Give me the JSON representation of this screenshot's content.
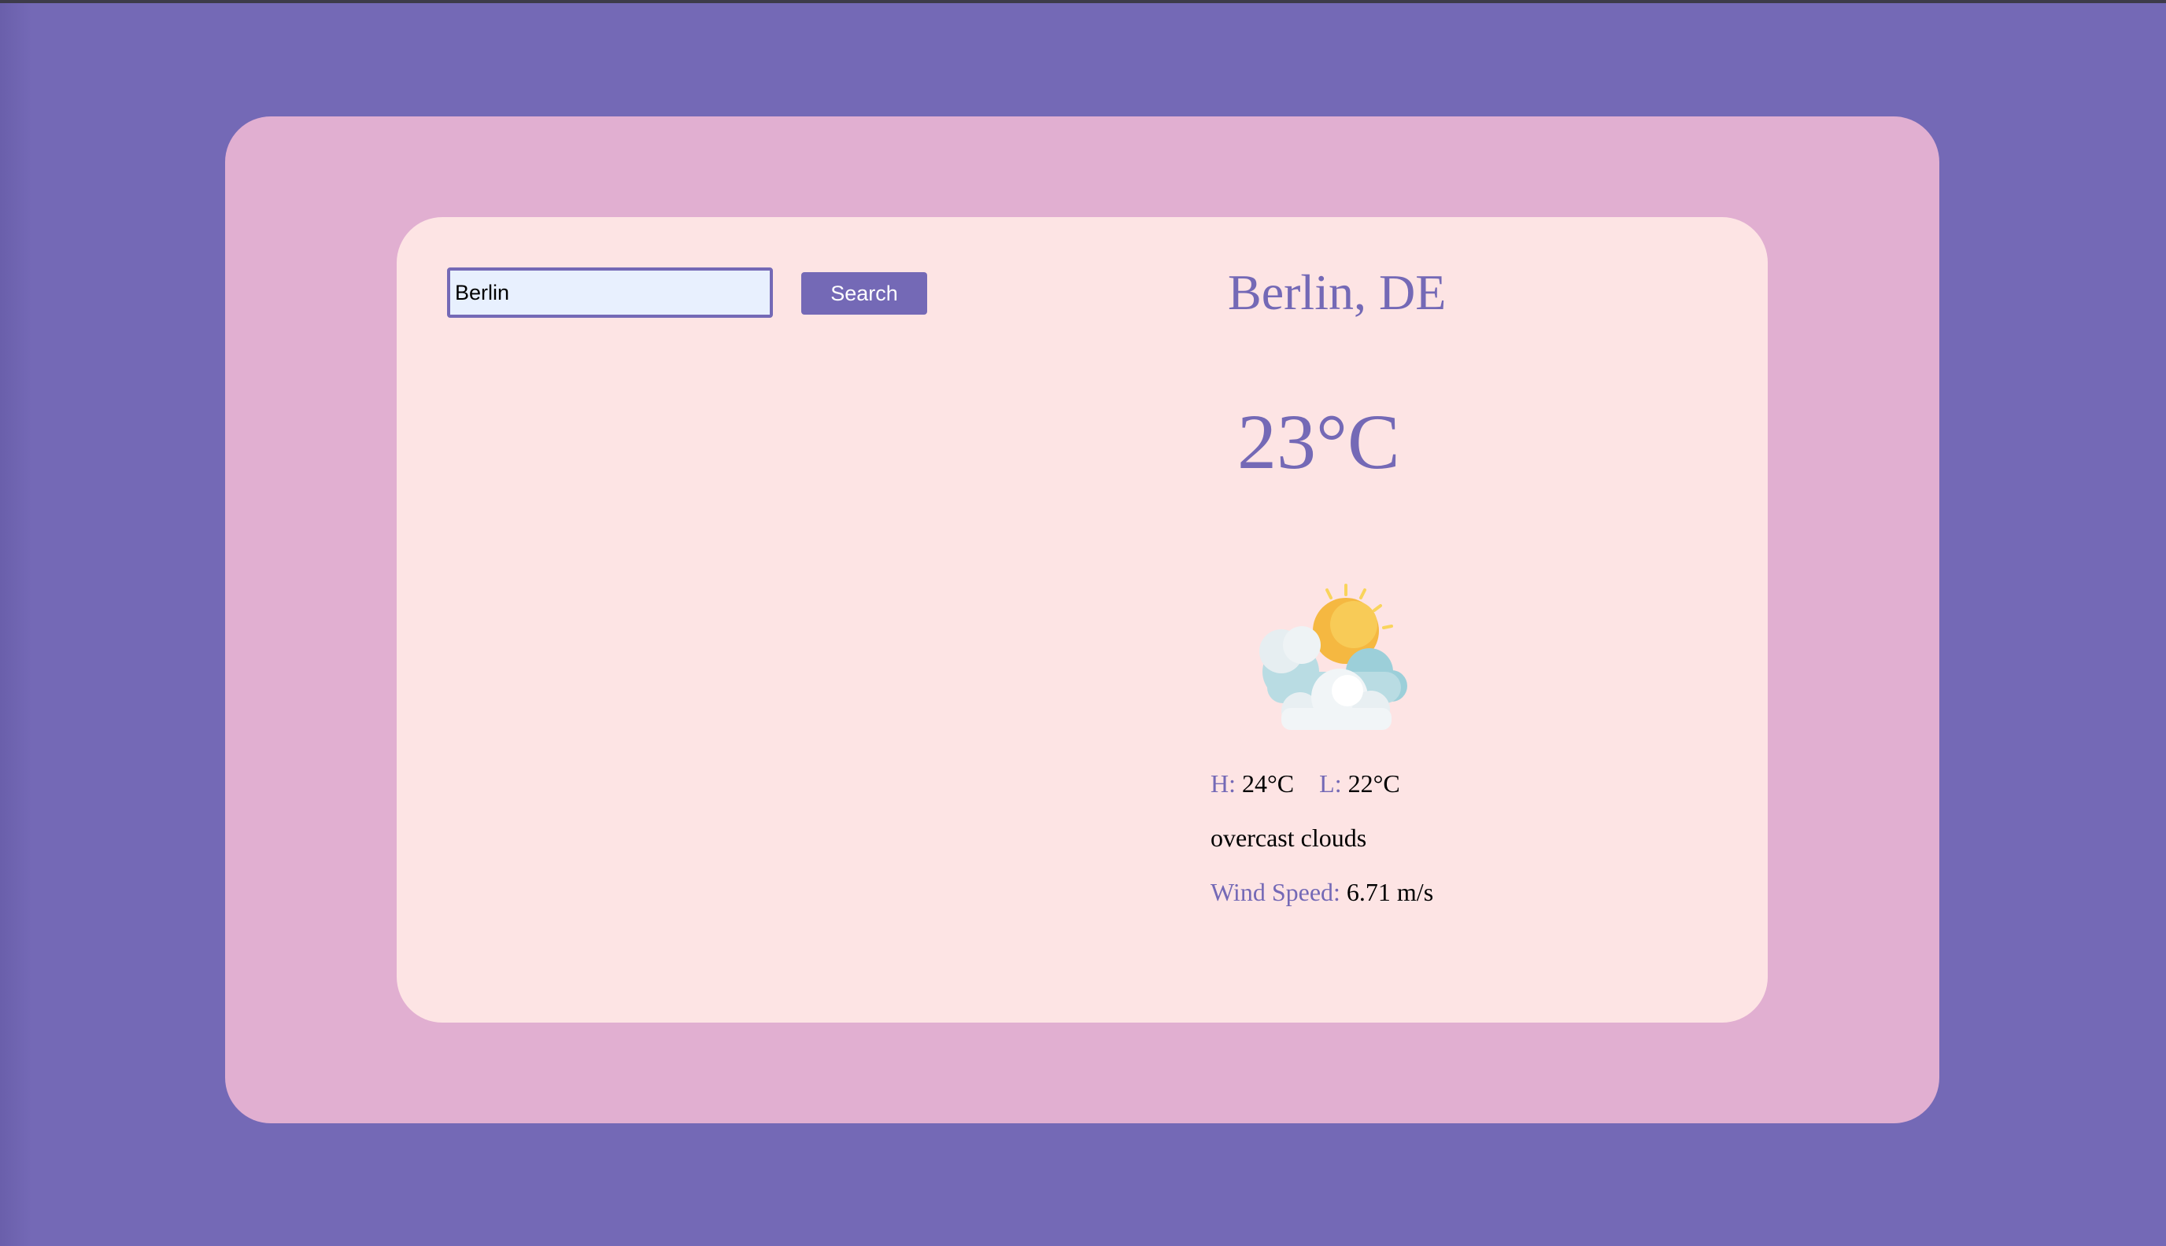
{
  "search": {
    "value": "Berlin",
    "button_label": "Search"
  },
  "weather": {
    "location": "Berlin, DE",
    "temperature": "23°C",
    "icon": "partly-cloudy-sun-icon",
    "high_label": "H:",
    "high_value": "24°C",
    "low_label": "L:",
    "low_value": "22°C",
    "description": "overcast clouds",
    "wind_label": "Wind Speed:",
    "wind_value": "6.71 m/s"
  },
  "colors": {
    "background": "#7469b6",
    "outer_panel": "#e1afd1",
    "card": "#fde4e4",
    "accent": "#7469b6",
    "input_bg": "#e8f0fe"
  }
}
